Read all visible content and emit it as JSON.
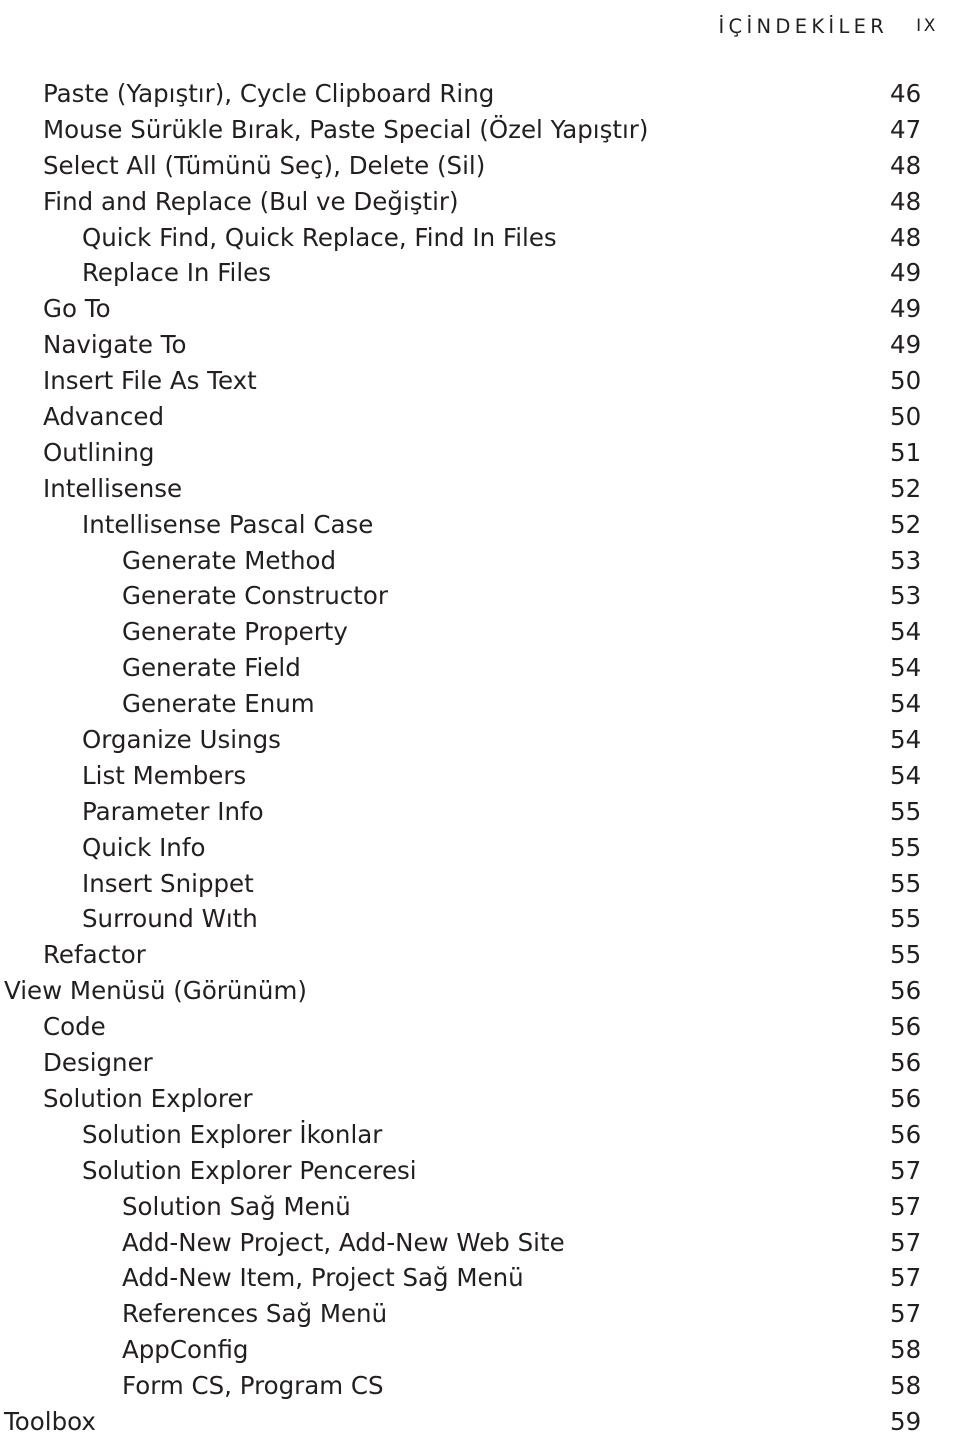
{
  "running_head": {
    "title": "İÇİNDEKİLER",
    "folio": "IX"
  },
  "page_type": "table-of-contents",
  "colors": {
    "text": "#231f20",
    "background": "#ffffff"
  },
  "toc": {
    "entries": [
      {
        "label": "Paste (Yapıştır), Cycle Clipboard Ring",
        "page": "46",
        "level": 1
      },
      {
        "label": "Mouse Sürükle Bırak, Paste Special (Özel Yapıştır)",
        "page": "47",
        "level": 1
      },
      {
        "label": "Select All (Tümünü Seç), Delete (Sil)",
        "page": "48",
        "level": 1
      },
      {
        "label": "Find and Replace (Bul ve Değiştir)",
        "page": "48",
        "level": 1
      },
      {
        "label": "Quick Find, Quick Replace, Find In Files",
        "page": "48",
        "level": 2
      },
      {
        "label": "Replace In Files",
        "page": "49",
        "level": 2
      },
      {
        "label": "Go To",
        "page": "49",
        "level": 1
      },
      {
        "label": "Navigate To",
        "page": "49",
        "level": 1
      },
      {
        "label": "Insert File As Text",
        "page": "50",
        "level": 1
      },
      {
        "label": "Advanced",
        "page": "50",
        "level": 1
      },
      {
        "label": "Outlining",
        "page": "51",
        "level": 1
      },
      {
        "label": "Intellisense",
        "page": "52",
        "level": 1
      },
      {
        "label": "Intellisense Pascal Case",
        "page": "52",
        "level": 2
      },
      {
        "label": "Generate Method",
        "page": "53",
        "level": 3
      },
      {
        "label": "Generate Constructor",
        "page": "53",
        "level": 3
      },
      {
        "label": "Generate Property",
        "page": "54",
        "level": 3
      },
      {
        "label": "Generate Field",
        "page": "54",
        "level": 3
      },
      {
        "label": "Generate Enum",
        "page": "54",
        "level": 3
      },
      {
        "label": "Organize Usings",
        "page": "54",
        "level": 2
      },
      {
        "label": "List Members",
        "page": "54",
        "level": 2
      },
      {
        "label": "Parameter Info",
        "page": "55",
        "level": 2
      },
      {
        "label": "Quick Info",
        "page": "55",
        "level": 2
      },
      {
        "label": "Insert Snippet",
        "page": "55",
        "level": 2
      },
      {
        "label": "Surround Wıth",
        "page": "55",
        "level": 2
      },
      {
        "label": "Refactor",
        "page": "55",
        "level": 1
      },
      {
        "label": "View Menüsü (Görünüm)",
        "page": "56",
        "level": 0
      },
      {
        "label": "Code",
        "page": "56",
        "level": 1
      },
      {
        "label": "Designer",
        "page": "56",
        "level": 1
      },
      {
        "label": "Solution Explorer",
        "page": "56",
        "level": 1
      },
      {
        "label": "Solution Explorer İkonlar",
        "page": "56",
        "level": 2
      },
      {
        "label": "Solution Explorer Penceresi",
        "page": "57",
        "level": 2
      },
      {
        "label": "Solution Sağ Menü",
        "page": "57",
        "level": 3
      },
      {
        "label": "Add-New Project, Add-New Web Site",
        "page": "57",
        "level": 3
      },
      {
        "label": "Add-New Item, Project Sağ Menü",
        "page": "57",
        "level": 3
      },
      {
        "label": "References Sağ Menü",
        "page": "57",
        "level": 3
      },
      {
        "label": "AppConfig",
        "page": "58",
        "level": 3
      },
      {
        "label": "Form CS, Program CS",
        "page": "58",
        "level": 3
      },
      {
        "label": "Toolbox",
        "page": "59",
        "level": 0
      }
    ]
  }
}
